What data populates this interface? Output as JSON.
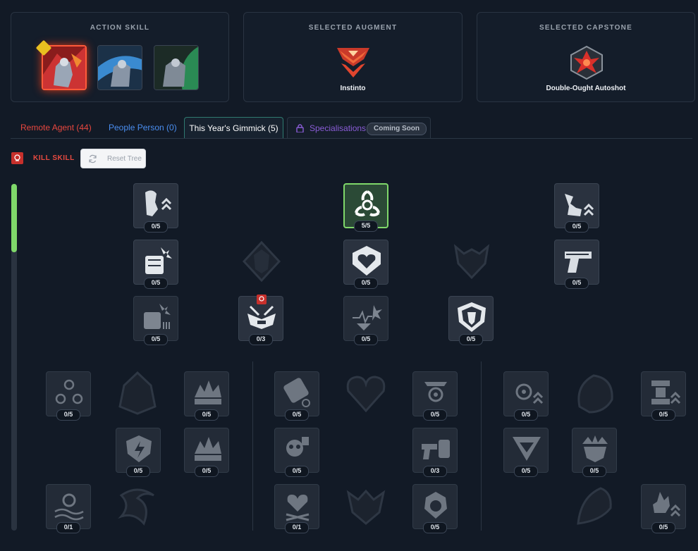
{
  "header": {
    "action_skill": {
      "title": "ACTION SKILL"
    },
    "augment": {
      "title": "SELECTED AUGMENT",
      "name": "Instinto"
    },
    "capstone": {
      "title": "SELECTED CAPSTONE",
      "name": "Double-Ought Autoshot"
    }
  },
  "tabs": [
    {
      "label": "Remote Agent (44)",
      "color": "#e8473f"
    },
    {
      "label": "People Person (0)",
      "color": "#4a8ef0"
    },
    {
      "label": "This Year's Gimmick (5)",
      "color": "#ffffff",
      "active": true
    },
    {
      "label": "Specialisations",
      "color": "#8a5cd6",
      "tag": "Coming Soon"
    }
  ],
  "kill_skill": {
    "label": "KILL SKILL",
    "reset_label": "Reset Tree"
  },
  "colors": {
    "accent_green": "#7fd86a",
    "kill_red": "#d93a3a",
    "background": "#121a26"
  },
  "tree": {
    "top_nodes": [
      {
        "icon": "head-upgrade-icon",
        "rank": "0/5"
      },
      {
        "icon": "biohazard-icon",
        "rank": "5/5"
      },
      {
        "icon": "boot-upgrade-icon",
        "rank": "0/5"
      },
      {
        "icon": "fist-impact-icon",
        "rank": "0/5"
      },
      {
        "icon": "heart-shield-icon",
        "rank": "0/5"
      },
      {
        "icon": "pistol-icon",
        "rank": "0/5"
      },
      {
        "icon": "fist-crash-icon",
        "rank": "0/5"
      },
      {
        "icon": "robot-mask-icon",
        "rank": "0/3"
      },
      {
        "icon": "heartbeat-blast-icon",
        "rank": "0/5"
      },
      {
        "icon": "shield-crest-icon",
        "rank": "0/5"
      }
    ],
    "branch_left": [
      {
        "icon": "triple-biohazard-icon",
        "rank": "0/5"
      },
      {
        "icon": "explosion-icon",
        "rank": "0/5"
      },
      {
        "icon": "shield-bolt-icon",
        "rank": "0/5"
      },
      {
        "icon": "explosion-icon",
        "rank": "0/5"
      },
      {
        "icon": "biohazard-wave-icon",
        "rank": "0/1"
      }
    ],
    "branch_middle": [
      {
        "icon": "gear-grenade-icon",
        "rank": "0/5"
      },
      {
        "icon": "eye-reticle-icon",
        "rank": "0/5"
      },
      {
        "icon": "skull-grenade-icon",
        "rank": "0/5"
      },
      {
        "icon": "gun-fist-icon",
        "rank": "0/3"
      },
      {
        "icon": "heart-crossbones-icon",
        "rank": "0/1"
      },
      {
        "icon": "skull-gear-icon",
        "rank": "0/5"
      }
    ],
    "branch_right": [
      {
        "icon": "biohazard-upgrade-icon",
        "rank": "0/5"
      },
      {
        "icon": "turret-upgrade-icon",
        "rank": "0/5"
      },
      {
        "icon": "shield-chevron-icon",
        "rank": "0/5"
      },
      {
        "icon": "crown-shield-icon",
        "rank": "0/5"
      },
      {
        "icon": "flame-upgrade-icon",
        "rank": "0/5"
      }
    ]
  }
}
